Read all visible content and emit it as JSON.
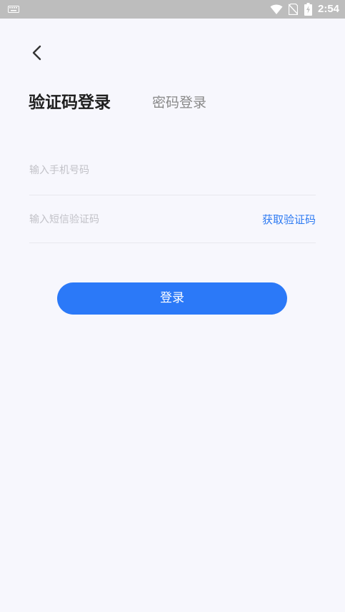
{
  "status_bar": {
    "time": "2:54",
    "icons": [
      "keyboard-icon",
      "wifi-icon",
      "no-sim-icon",
      "battery-charging-icon"
    ]
  },
  "nav": {
    "back_icon": "chevron-left-icon"
  },
  "tabs": {
    "active_label": "验证码登录",
    "inactive_label": "密码登录"
  },
  "form": {
    "phone_placeholder": "输入手机号码",
    "phone_value": "",
    "code_placeholder": "输入短信验证码",
    "code_value": "",
    "get_code_label": "获取验证码"
  },
  "login_button_label": "登录",
  "colors": {
    "accent": "#2b79f8",
    "link": "#2d7af2",
    "background": "#f7f7fd",
    "status_bar": "#bdbdbd"
  }
}
